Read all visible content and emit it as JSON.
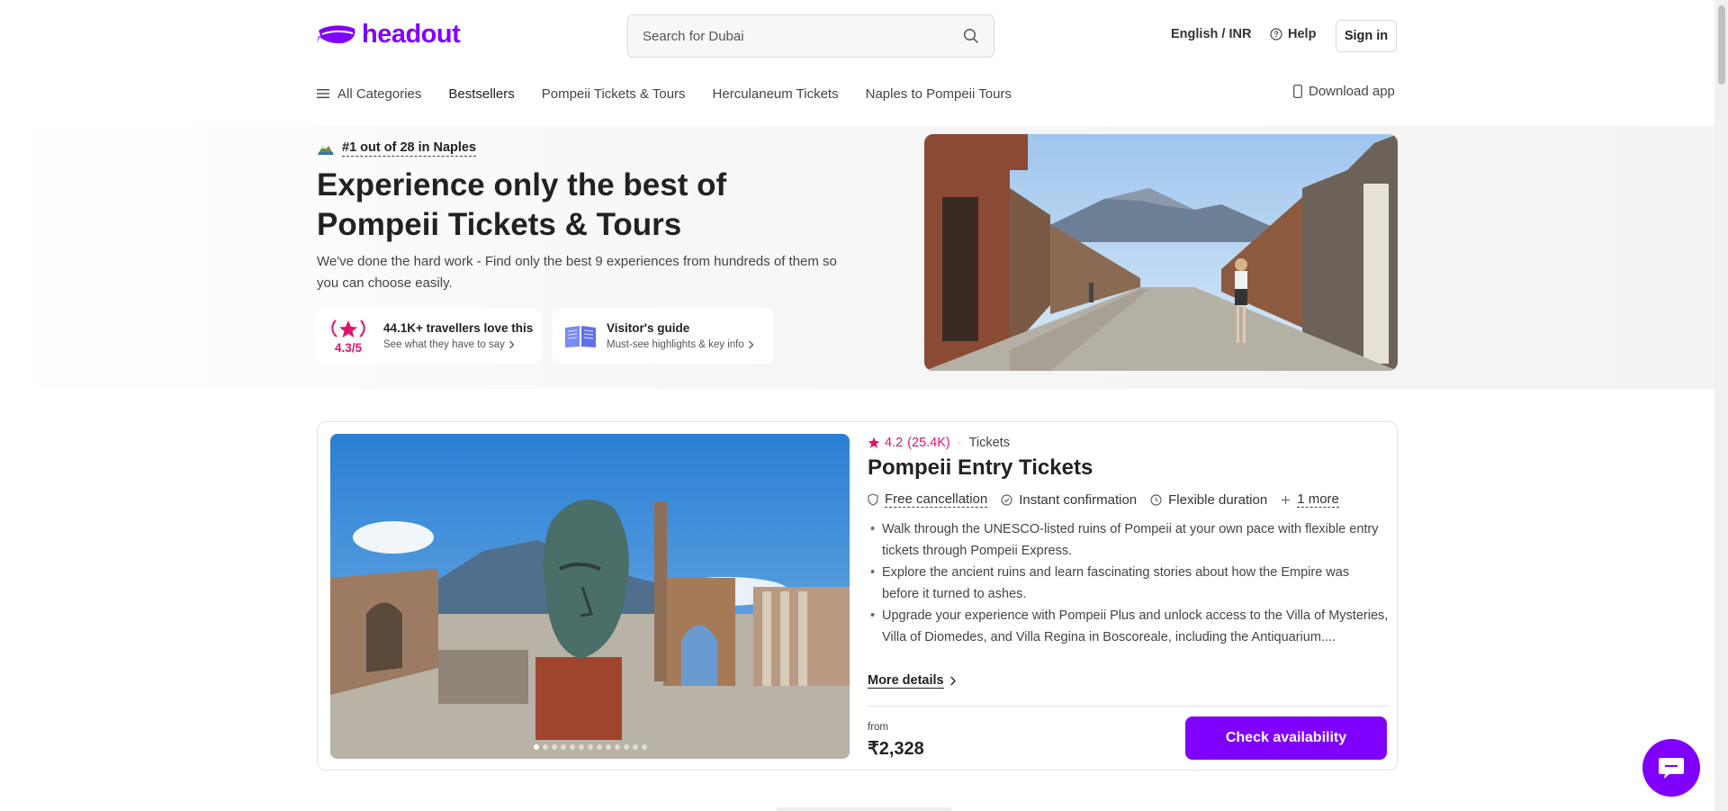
{
  "header": {
    "logo_text": "headout",
    "search_placeholder": "Search for Dubai",
    "language_currency": "English / INR",
    "help_label": "Help",
    "signin_label": "Sign in"
  },
  "nav": {
    "items": [
      "All Categories",
      "Bestsellers",
      "Pompeii Tickets & Tours",
      "Herculaneum Tickets",
      "Naples to Pompeii Tours"
    ],
    "download_label": "Download app"
  },
  "hero": {
    "rank_text": "#1 out of 28 in Naples",
    "title": "Experience only the best of Pompeii Tickets & Tours",
    "subtitle": "We've done the hard work - Find only the best 9 experiences from hundreds of them so you can choose easily.",
    "rating_score": "4.3/5",
    "love_title": "44.1K+ travellers love this",
    "love_sub": "See what they have to say",
    "guide_title": "Visitor's guide",
    "guide_sub": "Must-see highlights & key info"
  },
  "product": {
    "rating": "4.2",
    "reviews": "(25.4K)",
    "category": "Tickets",
    "title": "Pompeii Entry Tickets",
    "features": [
      "Free cancellation",
      "Instant confirmation",
      "Flexible duration",
      "1 more"
    ],
    "bullets": [
      "Walk through the UNESCO-listed ruins of Pompeii at your own pace with flexible entry tickets through Pompeii Express.",
      "Explore the ancient ruins and learn fascinating stories about how the Empire was before it turned to ashes.",
      "Upgrade your experience with Pompeii Plus and unlock access to the Villa of Mysteries, Villa of Diomedes, and Villa Regina in Boscoreale, including the Antiquarium...."
    ],
    "more_label": "More details",
    "from_label": "from",
    "price": "₹2,328",
    "cta_label": "Check availability",
    "carousel_total": 13,
    "carousel_active": 1
  },
  "colors": {
    "brand": "#8000ff",
    "rating_pink": "#e0136c"
  }
}
